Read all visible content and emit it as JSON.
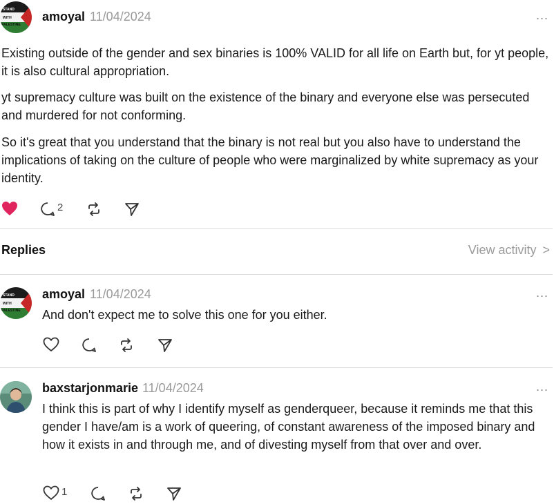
{
  "post": {
    "username": "amoyal",
    "date": "11/04/2024",
    "more": "...",
    "avatar": "palestine-flag-avatar",
    "paragraphs": [
      "Existing outside of the gender and sex binaries is 100% VALID for all life on Earth but, for yt people, it is also cultural appropriation.",
      "yt supremacy culture was built on the existence of the binary and everyone else was persecuted and murdered for not conforming.",
      "So it's great that you understand that the binary is not real but you also have to understand the implications of taking on the culture of people who were marginalized by white supremacy as your identity."
    ],
    "liked": true,
    "reply_count": "2",
    "like_color": "#e0245e"
  },
  "replies_section": {
    "title": "Replies",
    "view_activity": "View activity",
    "chevron": ">"
  },
  "replies": [
    {
      "username": "amoyal",
      "date": "11/04/2024",
      "more": "...",
      "avatar": "palestine-flag-avatar",
      "text": "And don't expect me to solve this one for you either.",
      "like_count": ""
    },
    {
      "username": "baxstarjonmarie",
      "date": "11/04/2024",
      "more": "...",
      "avatar": "person-photo-avatar",
      "text": "I think this is part of why I identify myself as genderqueer, because it reminds me that this gender I have/am is a work of queering, of constant awareness of the imposed binary and how it exists in and through me, and of divesting myself from that over and over.",
      "like_count": "1"
    }
  ]
}
